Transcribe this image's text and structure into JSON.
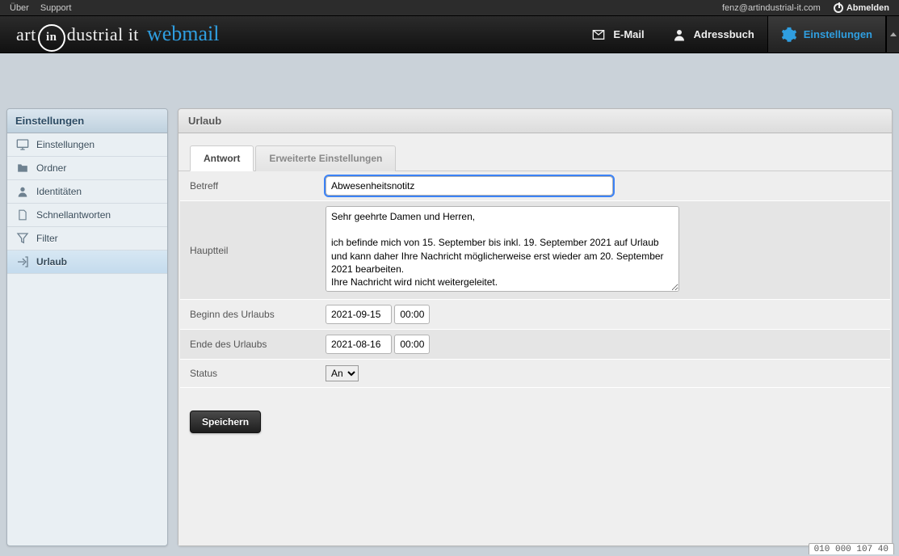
{
  "topline": {
    "about": "Über",
    "support": "Support",
    "user_email": "fenz@artindustrial-it.com",
    "logout": "Abmelden"
  },
  "logo": {
    "prefix": "art",
    "circle": "in",
    "suffix": "dustrial it",
    "product": "webmail"
  },
  "tasks": {
    "mail": "E-Mail",
    "addressbook": "Adressbuch",
    "settings": "Einstellungen"
  },
  "sidebar": {
    "title": "Einstellungen",
    "items": [
      {
        "label": "Einstellungen"
      },
      {
        "label": "Ordner"
      },
      {
        "label": "Identitäten"
      },
      {
        "label": "Schnellantworten"
      },
      {
        "label": "Filter"
      },
      {
        "label": "Urlaub"
      }
    ]
  },
  "content": {
    "title": "Urlaub",
    "tabs": {
      "reply": "Antwort",
      "advanced": "Erweiterte Einstellungen"
    },
    "form": {
      "subject_label": "Betreff",
      "subject_value": "Abwesenheitsnotitz",
      "body_label": "Hauptteil",
      "body_value": "Sehr geehrte Damen und Herren,\n\nich befinde mich von 15. September bis inkl. 19. September 2021 auf Urlaub und kann daher Ihre Nachricht möglicherweise erst wieder am 20. September 2021 bearbeiten.\nIhre Nachricht wird nicht weitergeleitet.\n\nIn dringenden Fällen wenden Sie sich bitte per Email an office@artindustrial-",
      "start_label": "Beginn des Urlaubs",
      "start_date": "2021-09-15",
      "start_time": "00:00",
      "end_label": "Ende des Urlaubs",
      "end_date": "2021-08-16",
      "end_time": "00:00",
      "status_label": "Status",
      "status_value": "An"
    },
    "save_button": "Speichern"
  },
  "corner_info": "010 000 107 40"
}
